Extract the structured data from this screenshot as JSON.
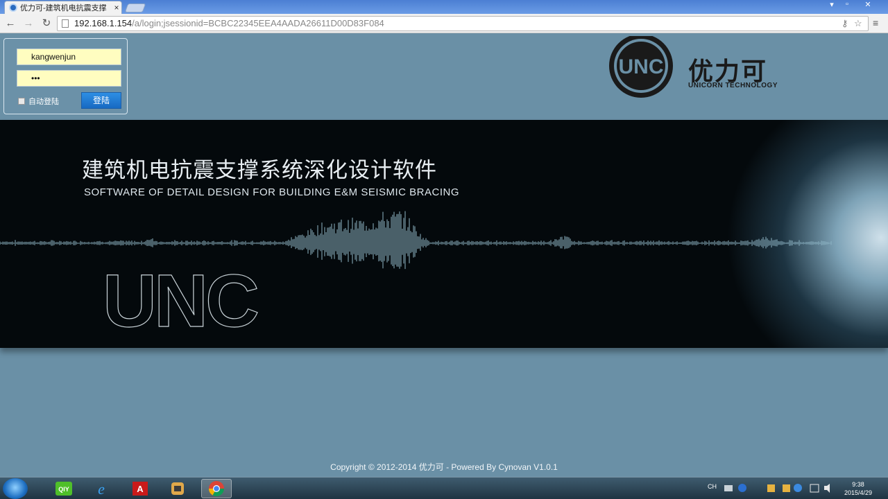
{
  "browser": {
    "tab_title": "优力可-建筑机电抗震支撑",
    "tab_close": "×",
    "url_host": "192.168.1.154",
    "url_path": "/a/login;jsessionid=BCBC22345EEA4AADA26611D00D83F084",
    "back": "←",
    "forward": "→",
    "reload": "↻",
    "menu": "≡",
    "key_icon": "⚷",
    "star": "☆",
    "minimize": "▾",
    "restore": "▫",
    "close": "✕"
  },
  "login": {
    "username": "kangwenjun",
    "password_mask": "•••",
    "remember_label": "自动登陆",
    "submit_label": "登陆"
  },
  "brand": {
    "logo_text": "UNC",
    "name": "优力可",
    "subtitle": "UNICORN TECHNOLOGY"
  },
  "banner": {
    "title": "建筑机电抗震支撑系统深化设计软件",
    "subtitle": "SOFTWARE OF DETAIL DESIGN FOR BUILDING E&M SEISMIC BRACING",
    "watermark_logo": "UNC"
  },
  "footer": {
    "copyright": "Copyright © 2012-2014 优力可 - Powered By Cynovan V1.0.1"
  },
  "taskbar": {
    "apps": [
      "iqiyi-icon",
      "internet-explorer-icon",
      "adobe-icon",
      "app-icon",
      "chrome-icon"
    ],
    "tray_lang": "CH",
    "time": "9:38",
    "date": "2015/4/29"
  }
}
